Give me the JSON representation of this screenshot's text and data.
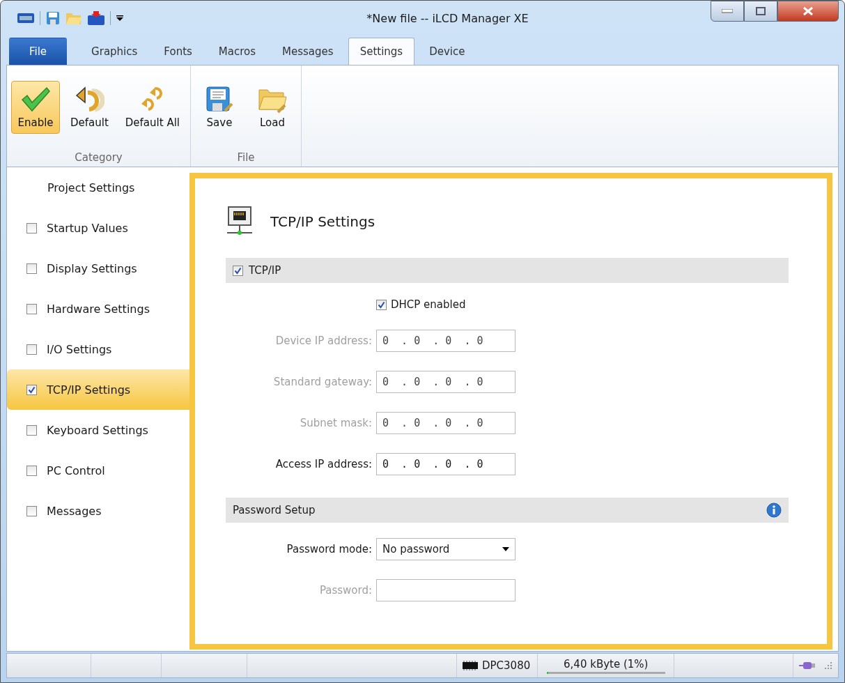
{
  "window": {
    "title": "*New file -- iLCD Manager XE"
  },
  "tabs": [
    {
      "label": "File",
      "kind": "file",
      "selected": false
    },
    {
      "label": "Graphics",
      "kind": "normal",
      "selected": false
    },
    {
      "label": "Fonts",
      "kind": "normal",
      "selected": false
    },
    {
      "label": "Macros",
      "kind": "normal",
      "selected": false
    },
    {
      "label": "Messages",
      "kind": "normal",
      "selected": false
    },
    {
      "label": "Settings",
      "kind": "normal",
      "selected": true
    },
    {
      "label": "Device",
      "kind": "normal",
      "selected": false
    }
  ],
  "ribbon": {
    "groups": [
      {
        "label": "Category",
        "buttons": [
          {
            "label": "Enable",
            "kind": "check",
            "selected": true
          },
          {
            "label": "Default",
            "kind": "undo",
            "selected": false
          },
          {
            "label": "Default All",
            "kind": "undo-all",
            "selected": false
          }
        ]
      },
      {
        "label": "File",
        "buttons": [
          {
            "label": "Save",
            "kind": "save",
            "selected": false
          },
          {
            "label": "Load",
            "kind": "load",
            "selected": false
          }
        ]
      }
    ]
  },
  "sidebar": {
    "header": "Project Settings",
    "items": [
      {
        "label": "Startup Values",
        "checked": false,
        "selected": false
      },
      {
        "label": "Display Settings",
        "checked": false,
        "selected": false
      },
      {
        "label": "Hardware Settings",
        "checked": false,
        "selected": false
      },
      {
        "label": "I/O Settings",
        "checked": false,
        "selected": false
      },
      {
        "label": "TCP/IP Settings",
        "checked": true,
        "selected": true
      },
      {
        "label": "Keyboard Settings",
        "checked": false,
        "selected": false
      },
      {
        "label": "PC Control",
        "checked": false,
        "selected": false
      },
      {
        "label": "Messages",
        "checked": false,
        "selected": false
      }
    ]
  },
  "content": {
    "title": "TCP/IP Settings",
    "tcpip": {
      "label": "TCP/IP",
      "checked": true
    },
    "dhcp": {
      "label": "DHCP enabled",
      "checked": true
    },
    "fields": [
      {
        "label": "Device IP address:",
        "value": "0  . 0  . 0  . 0",
        "disabled": true
      },
      {
        "label": "Standard gateway:",
        "value": "0  . 0  . 0  . 0",
        "disabled": true
      },
      {
        "label": "Subnet mask:",
        "value": "0  . 0  . 0  . 0",
        "disabled": true
      },
      {
        "label": "Access IP address:",
        "value": "0  . 0  . 0  . 0",
        "disabled": false
      }
    ],
    "password_section": {
      "label": "Password Setup"
    },
    "password_mode": {
      "label": "Password mode:",
      "value": "No password"
    },
    "password": {
      "label": "Password:",
      "disabled": true
    }
  },
  "status_bar": {
    "device": "DPC3080",
    "memory": "6,40 kByte (1%)",
    "level": 0.01
  }
}
